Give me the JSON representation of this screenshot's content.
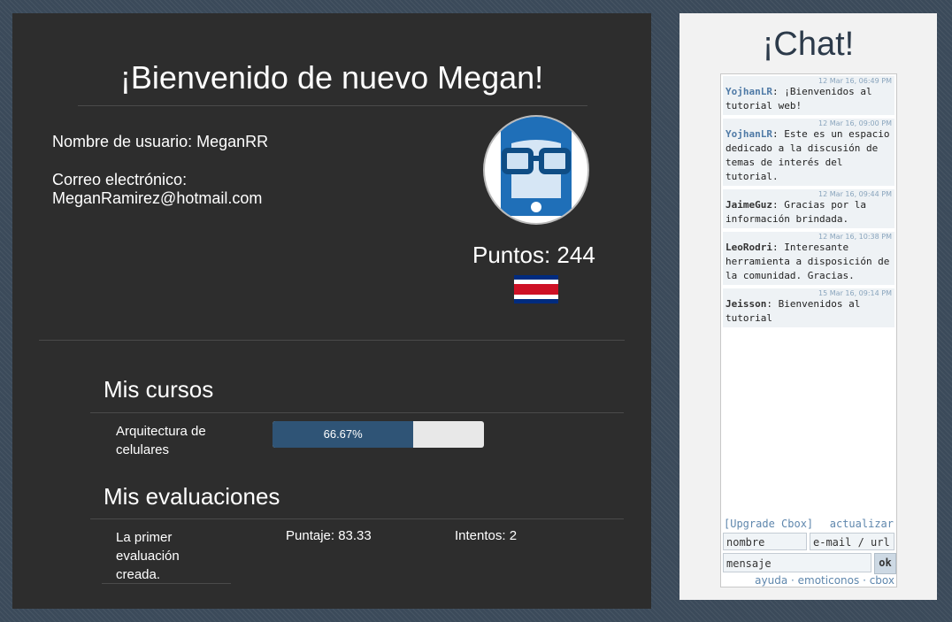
{
  "profile": {
    "welcome": "¡Bienvenido de nuevo Megan!",
    "username_line": "Nombre de usuario: MeganRR",
    "email_label": "Correo electrónico:",
    "email": "MeganRamirez@hotmail.com",
    "points": "Puntos: 244",
    "flag_colors": [
      "#002b7f",
      "#ffffff",
      "#ce1126"
    ]
  },
  "courses": {
    "title": "Mis cursos",
    "items": [
      {
        "name": "Arquitectura de celulares",
        "progress_label": "66.67%",
        "progress": 0.6667
      }
    ]
  },
  "evaluations": {
    "title": "Mis evaluaciones",
    "items": [
      {
        "name": "La primer evaluación creada.",
        "score": "Puntaje: 83.33",
        "attempts": "Intentos: 2"
      }
    ]
  },
  "chat": {
    "title": "¡Chat!",
    "messages": [
      {
        "time": "12 Mar 16, 06:49 PM",
        "user": "YojhanLR",
        "text": ": ¡Bienvenidos al tutorial web!"
      },
      {
        "time": "12 Mar 16, 09:00 PM",
        "user": "YojhanLR",
        "text": ": Este es un espacio dedicado a la discusión de temas de interés del tutorial."
      },
      {
        "time": "12 Mar 16, 09:44 PM",
        "user": "JaimeGuz",
        "text": ": Gracias por la información brindada."
      },
      {
        "time": "12 Mar 16, 10:38 PM",
        "user": "LeoRodri",
        "text": ": Interesante herramienta a disposición de la comunidad. Gracias."
      },
      {
        "time": "15 Mar 16, 09:14 PM",
        "user": "Jeisson",
        "text": ": Bienvenidos al tutorial"
      }
    ],
    "upgrade_link": "[Upgrade Cbox]",
    "refresh_link": "actualizar",
    "name_placeholder": "nombre",
    "url_placeholder": "e-mail / url",
    "message_placeholder": "mensaje",
    "ok_label": "ok",
    "help_link": "ayuda",
    "emoticons_link": "emoticonos",
    "cbox_link": "cbox",
    "link_color": "#5f87ad"
  }
}
